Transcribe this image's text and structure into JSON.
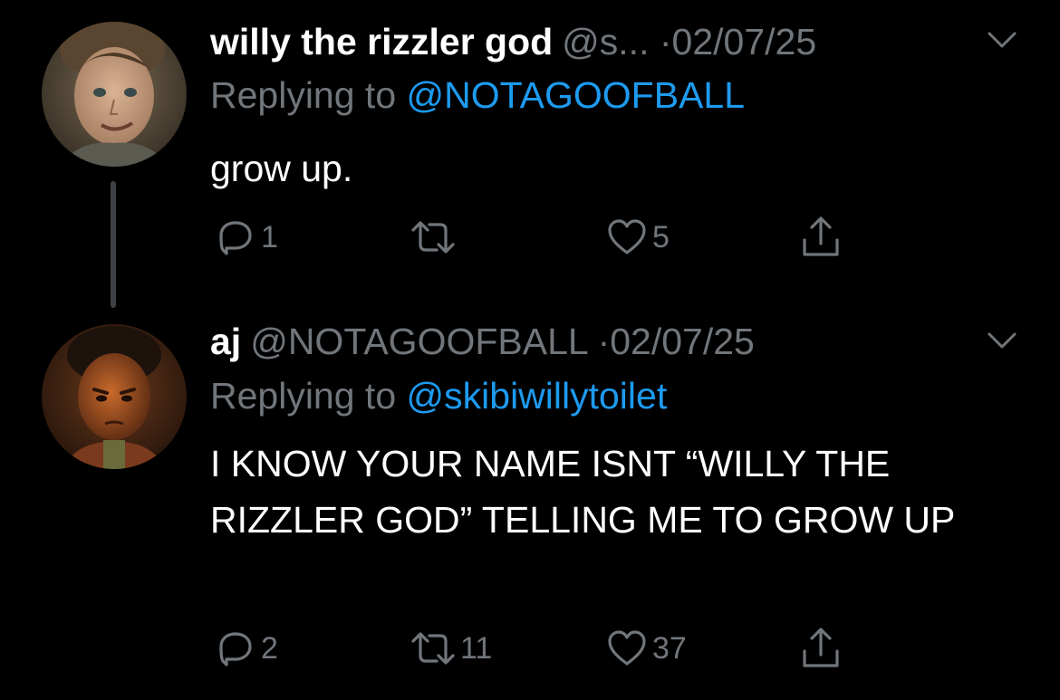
{
  "tweets": [
    {
      "display_name": "willy the rizzler god",
      "handle": "@s...",
      "dot": "·",
      "date": "02/07/25",
      "replying_prefix": "Replying to",
      "replying_mention": "@NOTAGOOFBALL",
      "text": "grow up.",
      "reply_count": "1",
      "retweet_count": "",
      "like_count": "5"
    },
    {
      "display_name": "aj",
      "handle": "@NOTAGOOFBALL",
      "dot": "·",
      "date": "02/07/25",
      "replying_prefix": "Replying to",
      "replying_mention": "@skibiwillytoilet",
      "text": "I KNOW YOUR NAME ISNT “WILLY THE RIZZLER GOD” TELLING ME TO GROW UP",
      "reply_count": "2",
      "retweet_count": "11",
      "like_count": "37"
    }
  ],
  "icons": {
    "reply": "reply-icon",
    "retweet": "retweet-icon",
    "like": "heart-icon",
    "share": "share-icon",
    "menu": "chevron-down-icon"
  },
  "colors": {
    "background": "#000000",
    "primary_text": "#ffffff",
    "secondary_text": "#71767b",
    "mention": "#1d9bf0",
    "thread_line": "#3d4146"
  }
}
